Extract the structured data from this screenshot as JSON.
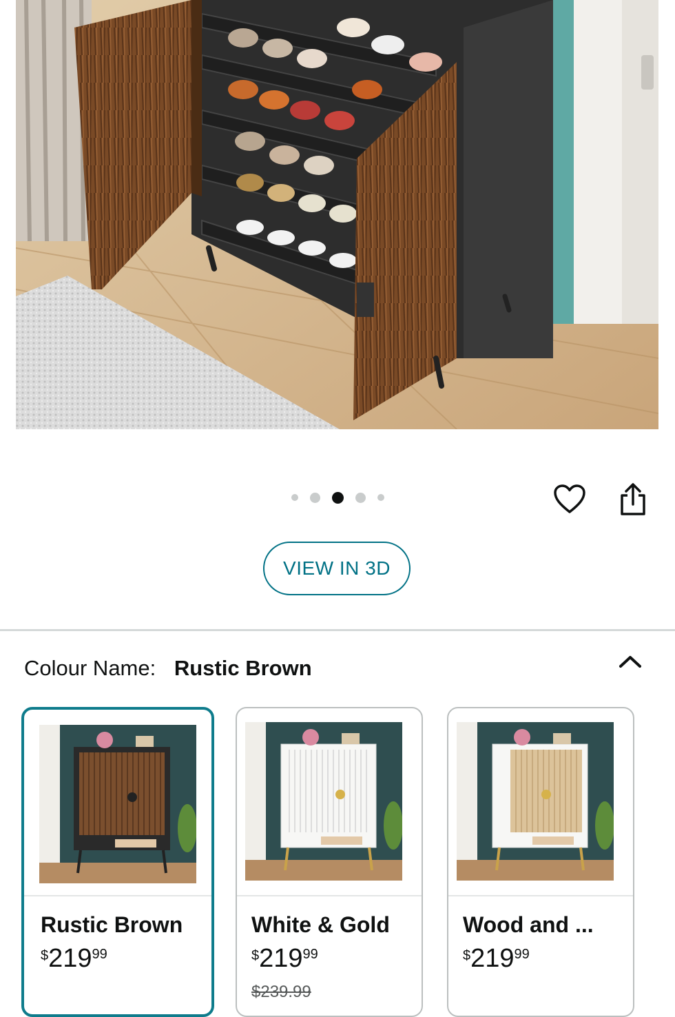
{
  "carousel": {
    "total": 5,
    "active_index": 2
  },
  "view_3d_label": "VIEW IN 3D",
  "colour": {
    "label": "Colour Name:",
    "value": "Rustic Brown"
  },
  "swatches": [
    {
      "name": "Rustic Brown",
      "currency": "$",
      "whole": "219",
      "fraction": "99",
      "was_price": "",
      "selected": true
    },
    {
      "name": "White & Gold",
      "currency": "$",
      "whole": "219",
      "fraction": "99",
      "was_price": "$239.99",
      "selected": false
    },
    {
      "name": "Wood and ...",
      "currency": "$",
      "whole": "219",
      "fraction": "99",
      "was_price": "",
      "selected": false
    }
  ],
  "colors": {
    "link_teal": "#007185",
    "selected_border": "#0f7c8c",
    "divider": "#d5d9d9"
  },
  "icons": [
    "heart-icon",
    "share-icon",
    "chevron-up-icon"
  ]
}
